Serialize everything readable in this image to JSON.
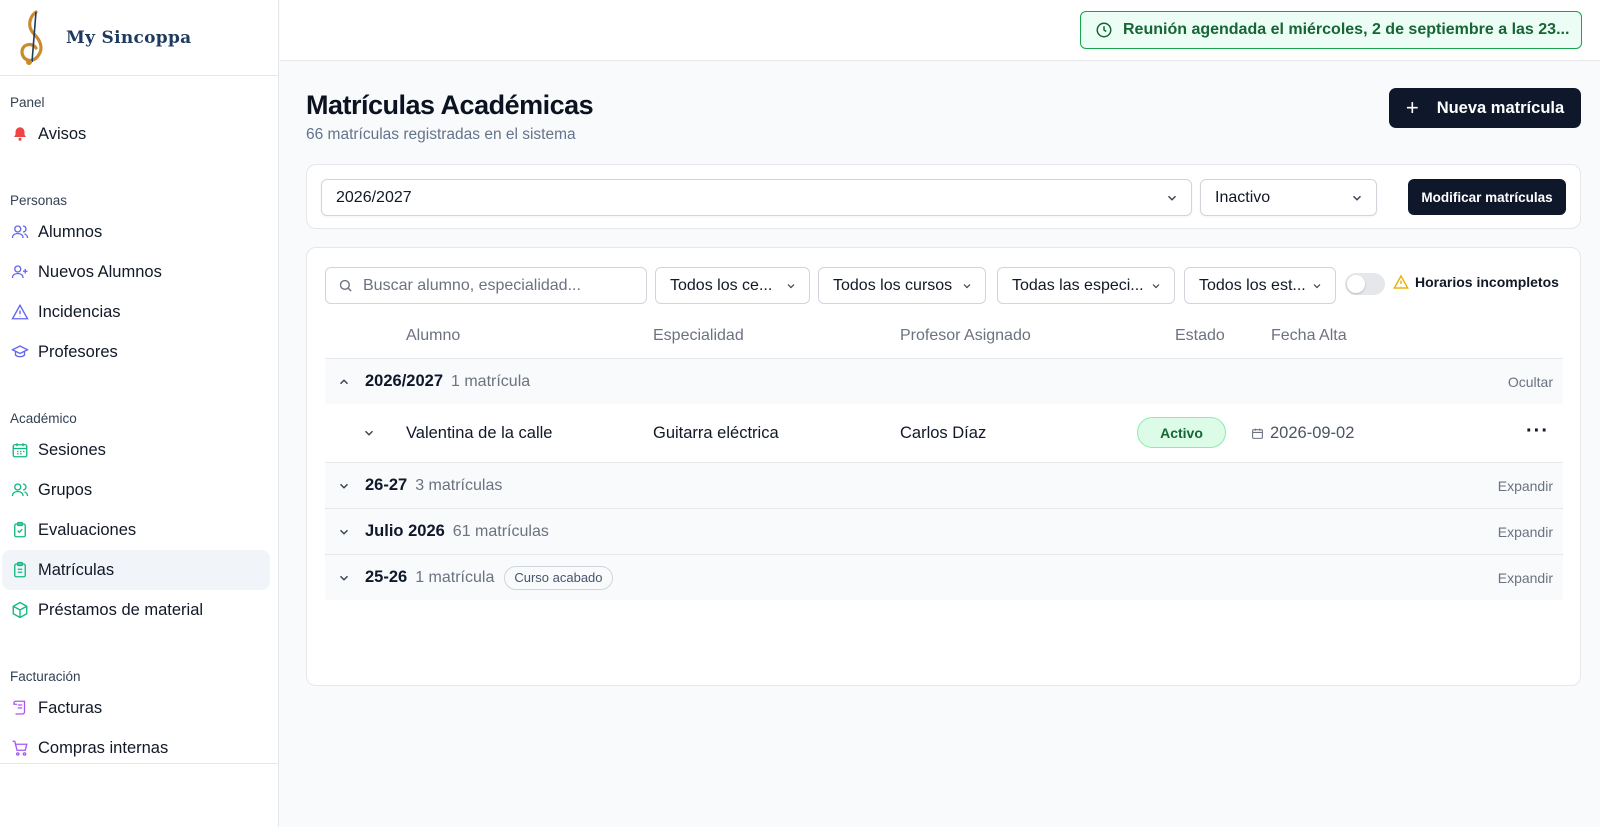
{
  "brand": {
    "name": "My Sincoppa"
  },
  "sidebar": {
    "sections": [
      {
        "title": "Panel",
        "items": [
          {
            "label": "Avisos",
            "icon": "bell-icon"
          }
        ]
      },
      {
        "title": "Personas",
        "items": [
          {
            "label": "Alumnos",
            "icon": "users-icon"
          },
          {
            "label": "Nuevos Alumnos",
            "icon": "user-plus-icon"
          },
          {
            "label": "Incidencias",
            "icon": "warning-icon"
          },
          {
            "label": "Profesores",
            "icon": "graduation-cap-icon"
          }
        ]
      },
      {
        "title": "Académico",
        "items": [
          {
            "label": "Sesiones",
            "icon": "calendar-icon"
          },
          {
            "label": "Grupos",
            "icon": "group-icon"
          },
          {
            "label": "Evaluaciones",
            "icon": "clipboard-check-icon"
          },
          {
            "label": "Matrículas",
            "icon": "clipboard-list-icon",
            "active": true
          },
          {
            "label": "Préstamos de material",
            "icon": "package-icon"
          }
        ]
      },
      {
        "title": "Facturación",
        "items": [
          {
            "label": "Facturas",
            "icon": "scroll-icon"
          },
          {
            "label": "Compras internas",
            "icon": "cart-icon"
          }
        ]
      }
    ]
  },
  "banner": {
    "text": "Reunión agendada el miércoles, 2 de septiembre a las 23..."
  },
  "page": {
    "title": "Matrículas Académicas",
    "subtitle": "66 matrículas registradas en el sistema",
    "new_button": "Nueva matrícula"
  },
  "filters": {
    "year": "2026/2027",
    "status": "Inactivo",
    "modify_button": "Modificar matrículas"
  },
  "table_filters": {
    "search_placeholder": "Buscar alumno, especialidad...",
    "centers": "Todos los ce...",
    "courses": "Todos los cursos",
    "specialties": "Todas las especi...",
    "states": "Todos los est...",
    "incomplete_label": "Horarios incompletos"
  },
  "table": {
    "headers": {
      "student": "Alumno",
      "specialty": "Especialidad",
      "teacher": "Profesor Asignado",
      "status": "Estado",
      "date": "Fecha Alta"
    },
    "groups": [
      {
        "name": "2026/2027",
        "count": "1 matrícula",
        "action": "Ocultar",
        "expanded": true
      },
      {
        "name": "26-27",
        "count": "3 matrículas",
        "action": "Expandir"
      },
      {
        "name": "Julio 2026",
        "count": "61 matrículas",
        "action": "Expandir"
      },
      {
        "name": "25-26",
        "count": "1 matrícula",
        "badge": "Curso acabado",
        "action": "Expandir"
      }
    ],
    "rows": [
      {
        "student": "Valentina de la calle",
        "specialty": "Guitarra eléctrica",
        "teacher": "Carlos Díaz",
        "status": "Activo",
        "date": "2026-09-02"
      }
    ]
  },
  "colors": {
    "accent": "#0f172a",
    "success": "#16a34a",
    "active_bg": "#dcfce7"
  }
}
